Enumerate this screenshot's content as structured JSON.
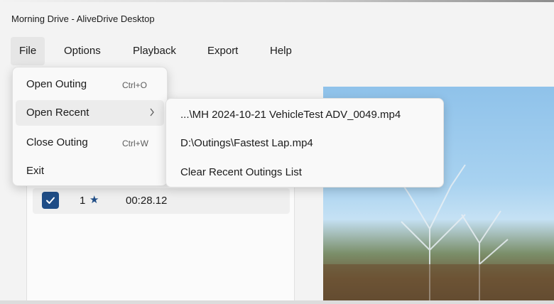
{
  "window": {
    "title": "Morning Drive - AliveDrive Desktop"
  },
  "menubar": {
    "items": [
      {
        "label": "File"
      },
      {
        "label": "Options"
      },
      {
        "label": "Playback"
      },
      {
        "label": "Export"
      },
      {
        "label": "Help"
      }
    ]
  },
  "file_menu": {
    "items": [
      {
        "label": "Open Outing",
        "shortcut": "Ctrl+O"
      },
      {
        "label": "Open Recent",
        "submenu_indicator": "chevron-right-icon"
      },
      {
        "label": "Close Outing",
        "shortcut": "Ctrl+W"
      },
      {
        "label": "Exit"
      }
    ]
  },
  "recent_submenu": {
    "items": [
      {
        "label": "...\\MH 2024-10-21 VehicleTest ADV_0049.mp4"
      },
      {
        "label": "D:\\Outings\\Fastest Lap.mp4"
      },
      {
        "label": "Clear Recent Outings List"
      }
    ]
  },
  "laps": [
    {
      "checked": true,
      "number": "1",
      "star": "★",
      "time": "00:28.12"
    }
  ],
  "colors": {
    "accent": "#1f4d86",
    "menu_bg": "#f9f9f9",
    "window_bg": "#f3f3f3"
  }
}
